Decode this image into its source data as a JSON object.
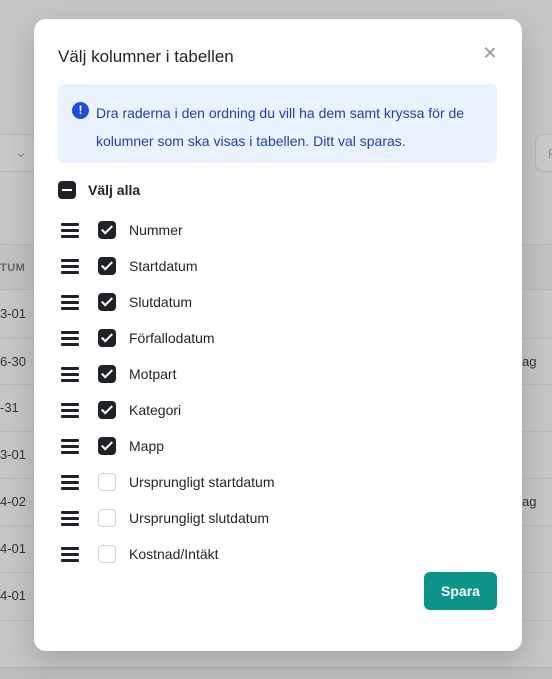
{
  "background": {
    "header_fragment": "TUM",
    "date_fragments": [
      "3-01",
      "6-30",
      "-31",
      "3-01",
      "4-02",
      "4-01",
      "4-01"
    ],
    "right_fragments": [
      "ag",
      "ag"
    ],
    "right_input_fragment": "F"
  },
  "modal": {
    "title": "Välj kolumner i tabellen",
    "info": "Dra raderna i den ordning du vill ha dem samt kryssa för de kolumner som ska visas i tabellen. Ditt val sparas.",
    "select_all_label": "Välj alla",
    "select_all_state": "indeterminate",
    "columns": [
      {
        "label": "Nummer",
        "checked": true
      },
      {
        "label": "Startdatum",
        "checked": true
      },
      {
        "label": "Slutdatum",
        "checked": true
      },
      {
        "label": "Förfallodatum",
        "checked": true
      },
      {
        "label": "Motpart",
        "checked": true
      },
      {
        "label": "Kategori",
        "checked": true
      },
      {
        "label": "Mapp",
        "checked": true
      },
      {
        "label": "Ursprungligt startdatum",
        "checked": false
      },
      {
        "label": "Ursprungligt slutdatum",
        "checked": false
      },
      {
        "label": "Kostnad/Intäkt",
        "checked": false
      }
    ],
    "save_label": "Spara"
  },
  "colors": {
    "primary": "#0d9488",
    "info_bg": "#eaf2fe",
    "info_text": "#1e40af",
    "overlay": "#c6c6c6"
  },
  "icons": [
    "close-icon",
    "info-icon",
    "drag-handle-icon",
    "checkbox-icon"
  ]
}
